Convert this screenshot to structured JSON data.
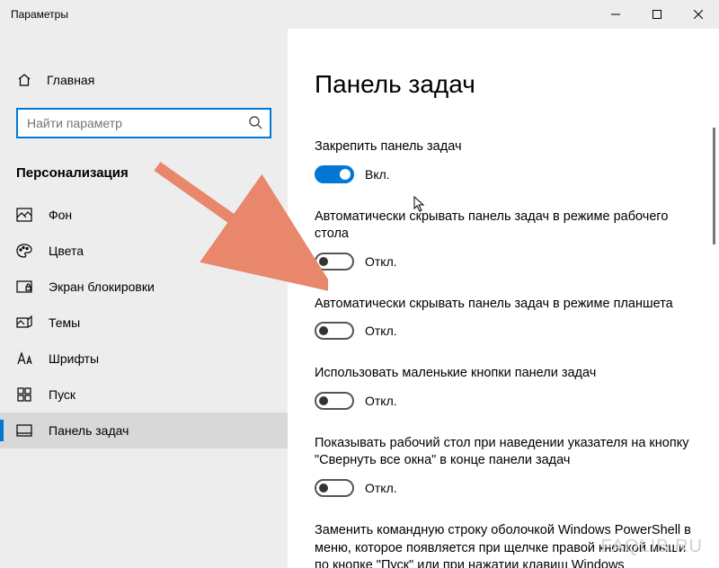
{
  "window": {
    "title": "Параметры"
  },
  "sidebar": {
    "home_label": "Главная",
    "search_placeholder": "Найти параметр",
    "section_title": "Персонализация",
    "items": [
      {
        "label": "Фон",
        "icon": "picture-icon"
      },
      {
        "label": "Цвета",
        "icon": "palette-icon"
      },
      {
        "label": "Экран блокировки",
        "icon": "lock-screen-icon"
      },
      {
        "label": "Темы",
        "icon": "themes-icon"
      },
      {
        "label": "Шрифты",
        "icon": "fonts-icon"
      },
      {
        "label": "Пуск",
        "icon": "start-icon"
      },
      {
        "label": "Панель задач",
        "icon": "taskbar-icon"
      }
    ]
  },
  "main": {
    "title": "Панель задач",
    "settings": [
      {
        "label": "Закрепить панель задач",
        "state": "Вкл.",
        "on": true
      },
      {
        "label": "Автоматически скрывать панель задач в режиме рабочего стола",
        "state": "Откл.",
        "on": false
      },
      {
        "label": "Автоматически скрывать панель задач в режиме планшета",
        "state": "Откл.",
        "on": false
      },
      {
        "label": "Использовать маленькие кнопки панели задач",
        "state": "Откл.",
        "on": false
      },
      {
        "label": "Показывать рабочий стол при наведении указателя на кнопку \"Свернуть все окна\" в конце панели задач",
        "state": "Откл.",
        "on": false
      },
      {
        "label": "Заменить командную строку оболочкой Windows PowerShell в меню, которое появляется при щелчке правой кнопкой мыши по кнопке \"Пуск\" или при нажатии клавиш Windows",
        "state": "",
        "on": false
      }
    ]
  },
  "watermark": "FAQLIB.RU"
}
